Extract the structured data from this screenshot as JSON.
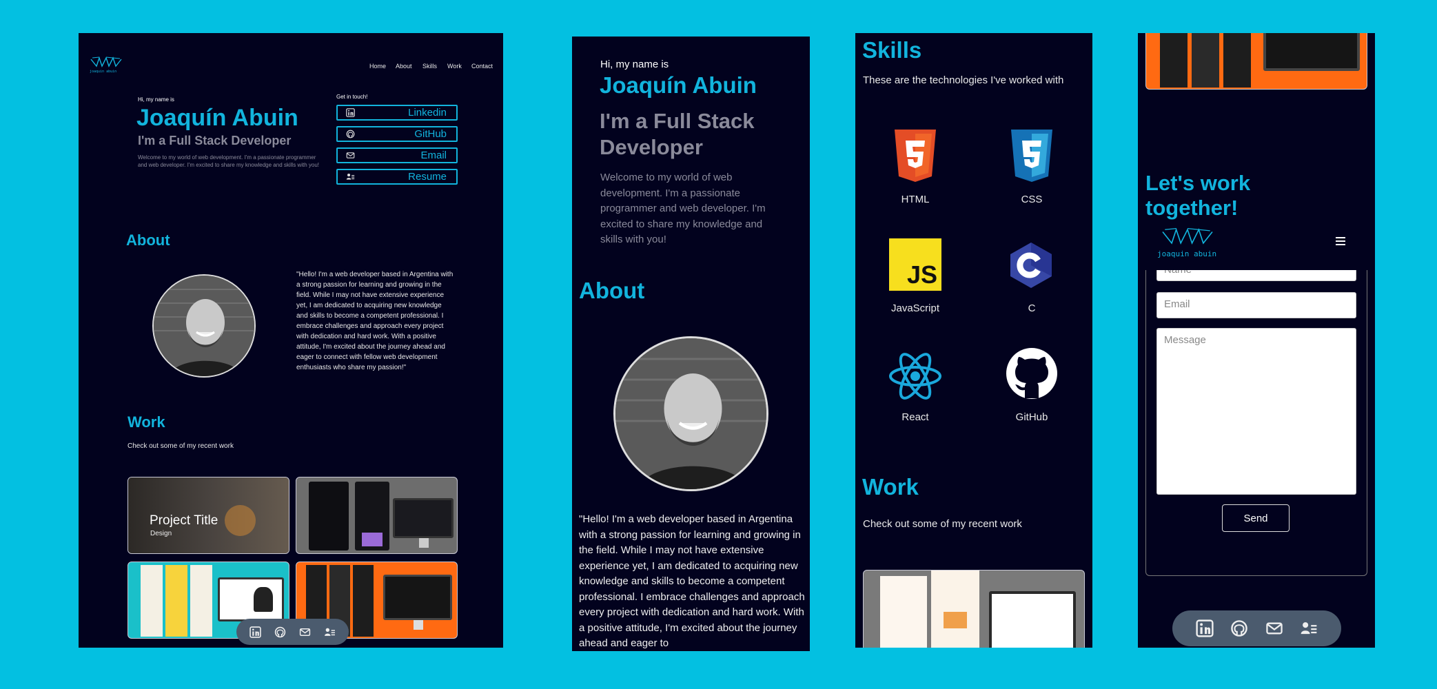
{
  "desktop": {
    "logo_text": "joaquin abuin",
    "nav": [
      "Home",
      "About",
      "Skills",
      "Work",
      "Contact"
    ],
    "hero": {
      "greeting": "Hi, my name is",
      "name": "Joaquín Abuin",
      "role": "I'm a Full Stack Developer",
      "intro": "Welcome to my world of web development. I'm a passionate programmer and web developer. I'm excited to share my knowledge and skills with you!"
    },
    "touch": {
      "heading": "Get in touch!",
      "buttons": [
        {
          "label": "Linkedin",
          "icon": "linkedin-icon"
        },
        {
          "label": "GitHub",
          "icon": "github-icon"
        },
        {
          "label": "Email",
          "icon": "mail-icon"
        },
        {
          "label": "Resume",
          "icon": "resume-icon"
        }
      ]
    },
    "about": {
      "title": "About",
      "text": "\"Hello! I'm a web developer based in Argentina with a strong passion for learning and growing in the field. While I may not have extensive experience yet, I am dedicated to acquiring new knowledge and skills to become a competent professional. I embrace challenges and approach every project with dedication and hard work. With a positive attitude, I'm excited about the journey ahead and eager to connect with fellow web development enthusiasts who share my passion!\""
    },
    "work": {
      "title": "Work",
      "subtitle": "Check out some of my recent work",
      "project_title": "Project Title",
      "project_category": "Design"
    },
    "social_bar": [
      "linkedin-icon",
      "github-icon",
      "mail-icon",
      "resume-icon"
    ]
  },
  "mobile_hero": {
    "greeting": "Hi, my name is",
    "name": "Joaquín Abuin",
    "role": "I'm a Full Stack Developer",
    "intro": "Welcome to my world of web development. I'm a passionate programmer and web developer. I'm excited to share my knowledge and skills with you!",
    "about_title": "About",
    "about_text": "\"Hello! I'm a web developer based in Argentina with a strong passion for learning and growing in the field. While I may not have extensive experience yet, I am dedicated to acquiring new knowledge and skills to become a competent professional. I embrace challenges and approach every project with dedication and hard work. With a positive attitude, I'm excited about the journey ahead and eager to"
  },
  "mobile_skills": {
    "title": "Skills",
    "subtitle": "These are the technologies I've worked with",
    "skills": [
      {
        "label": "HTML",
        "icon": "html5-icon"
      },
      {
        "label": "CSS",
        "icon": "css3-icon"
      },
      {
        "label": "JavaScript",
        "icon": "javascript-icon"
      },
      {
        "label": "C",
        "icon": "c-language-icon"
      },
      {
        "label": "React",
        "icon": "react-icon"
      },
      {
        "label": "GitHub",
        "icon": "github-icon"
      }
    ],
    "work_title": "Work",
    "work_subtitle": "Check out some of my recent work"
  },
  "mobile_contact": {
    "title": "Let's work together!",
    "logo_text": "joaquin abuin",
    "menu_icon": "hamburger-icon",
    "name_placeholder": "Name",
    "email_placeholder": "Email",
    "message_placeholder": "Message",
    "send_label": "Send"
  },
  "colors": {
    "background": "#03c0e1",
    "panel": "#02021e",
    "accent": "#12b4dd",
    "muted": "#8a8a9a"
  }
}
